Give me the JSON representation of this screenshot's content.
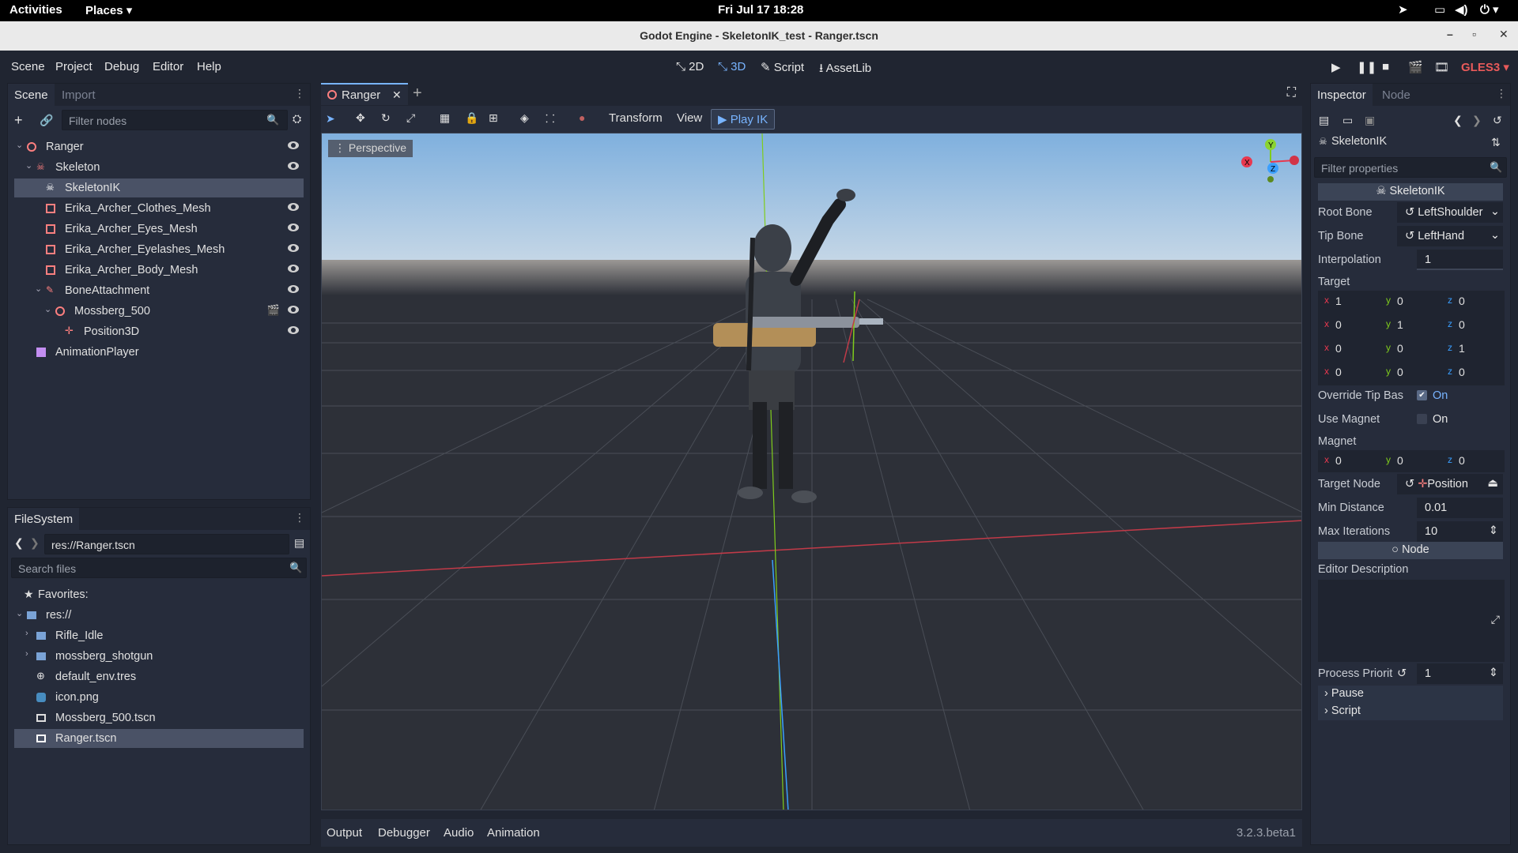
{
  "system_bar": {
    "activities": "Activities",
    "places": "Places",
    "datetime": "Fri Jul 17  18:28"
  },
  "window": {
    "title": "Godot Engine - SkeletonIK_test - Ranger.tscn"
  },
  "menu": {
    "items": [
      "Scene",
      "Project",
      "Debug",
      "Editor",
      "Help"
    ]
  },
  "workspaces": {
    "w2d": "2D",
    "w3d": "3D",
    "script": "Script",
    "assetlib": "AssetLib",
    "renderer": "GLES3"
  },
  "scene_dock": {
    "tabs": [
      "Scene",
      "Import"
    ],
    "filter_placeholder": "Filter nodes",
    "nodes": [
      {
        "label": "Ranger"
      },
      {
        "label": "Skeleton"
      },
      {
        "label": "SkeletonIK"
      },
      {
        "label": "Erika_Archer_Clothes_Mesh"
      },
      {
        "label": "Erika_Archer_Eyes_Mesh"
      },
      {
        "label": "Erika_Archer_Eyelashes_Mesh"
      },
      {
        "label": "Erika_Archer_Body_Mesh"
      },
      {
        "label": "BoneAttachment"
      },
      {
        "label": "Mossberg_500"
      },
      {
        "label": "Position3D"
      },
      {
        "label": "AnimationPlayer"
      }
    ]
  },
  "filesystem_dock": {
    "tab": "FileSystem",
    "path": "res://Ranger.tscn",
    "search_placeholder": "Search files",
    "items": [
      {
        "label": "Favorites:"
      },
      {
        "label": "res://"
      },
      {
        "label": "Rifle_Idle"
      },
      {
        "label": "mossberg_shotgun"
      },
      {
        "label": "default_env.tres"
      },
      {
        "label": "icon.png"
      },
      {
        "label": "Mossberg_500.tscn"
      },
      {
        "label": "Ranger.tscn"
      }
    ]
  },
  "editor_tabs": {
    "active": "Ranger"
  },
  "viewport_toolbar": {
    "transform": "Transform",
    "view": "View",
    "play_ik": "Play IK"
  },
  "viewport": {
    "perspective_label": "Perspective",
    "gizmo": {
      "x": "X",
      "y": "Y",
      "z": "Z"
    }
  },
  "inspector": {
    "tabs": [
      "Inspector",
      "Node"
    ],
    "node_name": "SkeletonIK",
    "filter_placeholder": "Filter properties",
    "class_header": "SkeletonIK",
    "root_bone_label": "Root Bone",
    "root_bone": "LeftShoulder",
    "tip_bone_label": "Tip Bone",
    "tip_bone": "LeftHand",
    "interpolation_label": "Interpolation",
    "interpolation": "1",
    "target_label": "Target",
    "target_rows": [
      [
        "1",
        "0",
        "0"
      ],
      [
        "0",
        "1",
        "0"
      ],
      [
        "0",
        "0",
        "1"
      ],
      [
        "0",
        "0",
        "0"
      ]
    ],
    "override_label": "Override Tip Bas",
    "override_value": "On",
    "use_magnet_label": "Use Magnet",
    "use_magnet_value": "On",
    "magnet_label": "Magnet",
    "magnet": [
      "0",
      "0",
      "0"
    ],
    "target_node_label": "Target Node",
    "target_node": "Position",
    "min_distance_label": "Min Distance",
    "min_distance": "0.01",
    "max_iterations_label": "Max Iterations",
    "max_iterations": "10",
    "node_section": "Node",
    "editor_description_label": "Editor Description",
    "process_priority_label": "Process Priorit",
    "process_priority": "1",
    "pause_label": "Pause",
    "script_label": "Script"
  },
  "bottom_panel": {
    "tabs": [
      "Output",
      "Debugger",
      "Audio",
      "Animation"
    ],
    "version": "3.2.3.beta1"
  },
  "colors": {
    "accent": "#78b4ff",
    "bg": "#202531",
    "panel": "#262c3b",
    "x_axis": "#e8384f",
    "y_axis": "#7fcc1c",
    "z_axis": "#3a9fff"
  }
}
